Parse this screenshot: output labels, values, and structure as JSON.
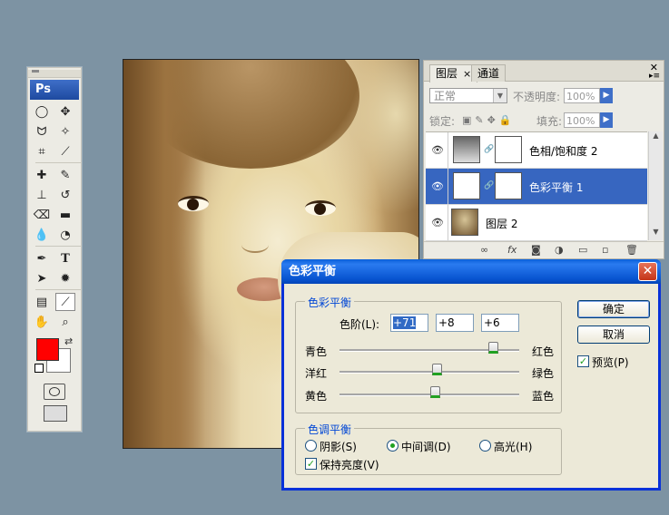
{
  "toolbox": {
    "logo": "Ps"
  },
  "layers_panel": {
    "tabs": [
      {
        "label": "图层",
        "close": "×"
      },
      {
        "label": "通道"
      }
    ],
    "blend_mode": "正常",
    "opacity_label": "不透明度:",
    "opacity_value": "100%",
    "lock_label": "锁定:",
    "fill_label": "填充:",
    "fill_value": "100%",
    "layers": [
      {
        "name": "色相/饱和度 2"
      },
      {
        "name": "色彩平衡 1",
        "selected": true
      },
      {
        "name": "图层 2"
      }
    ],
    "bottom_icons": [
      "link-icon",
      "fx-icon",
      "mask-icon",
      "adjustment-icon",
      "folder-icon",
      "new-layer-icon",
      "trash-icon"
    ],
    "fx_text": "fx"
  },
  "dialog": {
    "title": "色彩平衡",
    "close": "✕",
    "color_balance_group": "色彩平衡",
    "levels_label": "色阶(L):",
    "levels": [
      "+71",
      "+8",
      "+6"
    ],
    "sliders": [
      {
        "left": "青色",
        "right": "红色",
        "value": 71
      },
      {
        "left": "洋红",
        "right": "绿色",
        "value": 8
      },
      {
        "left": "黄色",
        "right": "蓝色",
        "value": 6
      }
    ],
    "tone_group": "色调平衡",
    "tones": [
      {
        "label": "阴影(S)",
        "checked": false
      },
      {
        "label": "中间调(D)",
        "checked": true
      },
      {
        "label": "高光(H)",
        "checked": false
      }
    ],
    "preserve_luminosity": "保持亮度(V)",
    "ok": "确定",
    "cancel": "取消",
    "preview": "预览(P)"
  }
}
